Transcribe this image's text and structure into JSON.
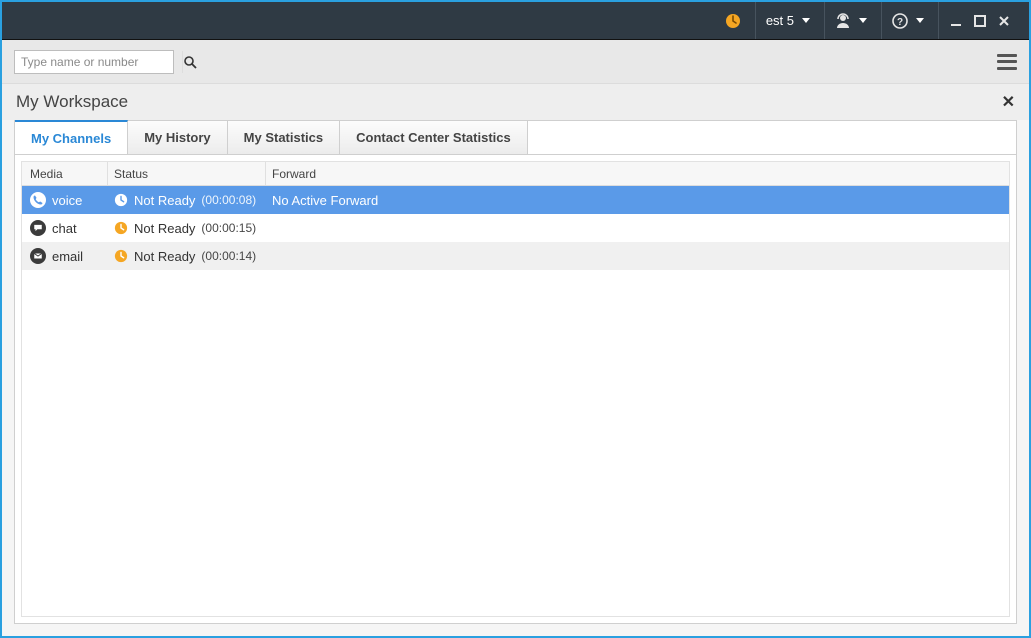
{
  "titlebar": {
    "status_icon": "clock-status-icon",
    "user_label": "est 5"
  },
  "search": {
    "placeholder": "Type name or number"
  },
  "workspace": {
    "title": "My Workspace"
  },
  "tabs": [
    {
      "label": "My Channels",
      "active": true
    },
    {
      "label": "My History",
      "active": false
    },
    {
      "label": "My Statistics",
      "active": false
    },
    {
      "label": "Contact Center Statistics",
      "active": false
    }
  ],
  "grid": {
    "headers": {
      "media": "Media",
      "status": "Status",
      "forward": "Forward"
    },
    "rows": [
      {
        "icon": "phone-icon",
        "media": "voice",
        "status_icon": "clock-icon",
        "status": "Not Ready",
        "time": "(00:00:08)",
        "forward": "No Active Forward",
        "selected": true
      },
      {
        "icon": "chat-icon",
        "media": "chat",
        "status_icon": "clock-icon",
        "status": "Not Ready",
        "time": "(00:00:15)",
        "forward": "",
        "selected": false
      },
      {
        "icon": "email-icon",
        "media": "email",
        "status_icon": "clock-icon",
        "status": "Not Ready",
        "time": "(00:00:14)",
        "forward": "",
        "selected": false
      }
    ]
  }
}
